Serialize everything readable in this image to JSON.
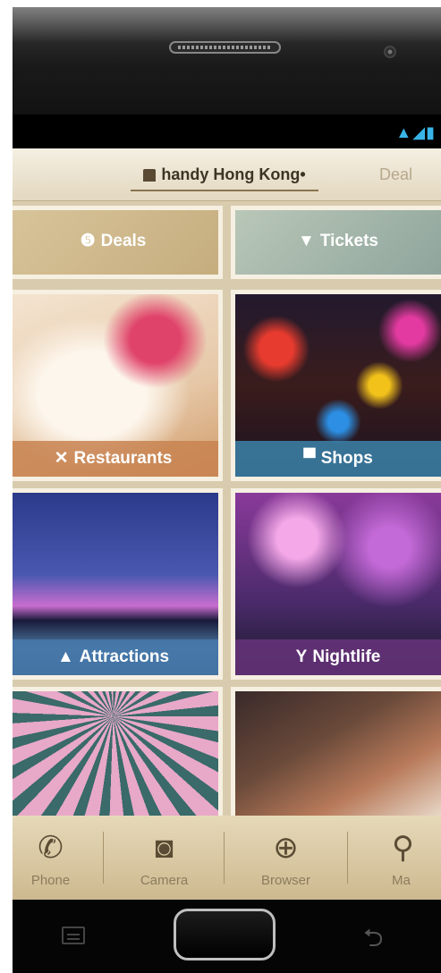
{
  "status_bar": {
    "icons": [
      "wifi-icon",
      "signal-icon",
      "battery-icon"
    ],
    "glyphs": "▲◢▮"
  },
  "app_bar": {
    "title": "handy Hong Kong",
    "title_suffix": "•",
    "next_tab": "Deal"
  },
  "tiles": [
    {
      "key": "deals",
      "label": "Deals",
      "icon": "dollar-icon",
      "icon_glyph": "❺"
    },
    {
      "key": "tickets",
      "label": "Tickets",
      "icon": "ticket-icon",
      "icon_glyph": "▼"
    },
    {
      "key": "restaurants",
      "label": "Restaurants",
      "icon": "fork-knife-icon",
      "icon_glyph": "✕"
    },
    {
      "key": "shops",
      "label": "Shops",
      "icon": "shopping-bag-icon",
      "icon_glyph": "▀"
    },
    {
      "key": "attractions",
      "label": "Attractions",
      "icon": "mountain-icon",
      "icon_glyph": "▲"
    },
    {
      "key": "nightlife",
      "label": "Nightlife",
      "icon": "cocktail-icon",
      "icon_glyph": "Y"
    }
  ],
  "dock": [
    {
      "label": "Phone",
      "icon": "phone-icon",
      "glyph": "✆"
    },
    {
      "label": "Camera",
      "icon": "camera-icon",
      "glyph": "◙"
    },
    {
      "label": "Browser",
      "icon": "globe-icon",
      "glyph": "⊕"
    },
    {
      "label": "Ma",
      "icon": "map-pin-icon",
      "glyph": "⚲"
    }
  ],
  "nav": {
    "back_glyph": "⮌"
  },
  "colors": {
    "accent": "#39b4e6",
    "app_bar": "#efe7d4",
    "dock": "#d8c7a2"
  }
}
